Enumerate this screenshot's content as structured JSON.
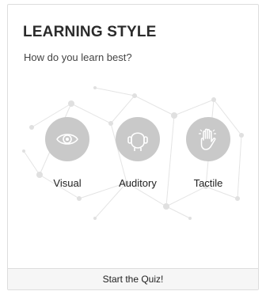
{
  "card": {
    "title": "LEARNING STYLE",
    "subtitle": "How do you learn best?"
  },
  "options": [
    {
      "label": "Visual",
      "icon": "eye-icon"
    },
    {
      "label": "Auditory",
      "icon": "listening-head-icon"
    },
    {
      "label": "Tactile",
      "icon": "hand-icon"
    }
  ],
  "footer": {
    "cta_label": "Start the Quiz!"
  },
  "colors": {
    "icon_circle": "#c9c9c9",
    "icon_stroke": "#ffffff",
    "footer_background": "#f6f6f6",
    "border": "#dddddd",
    "background_network": "#e4e4e4"
  }
}
